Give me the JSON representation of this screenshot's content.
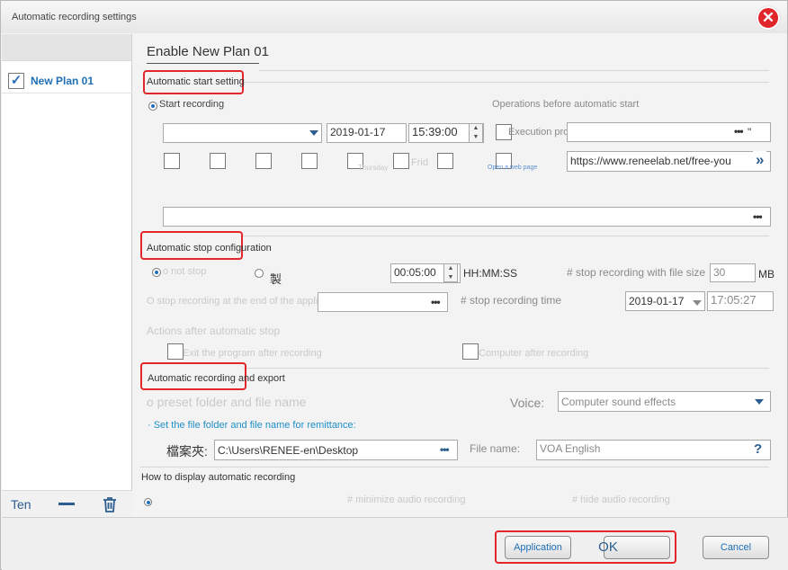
{
  "window": {
    "title": "Automatic recording settings"
  },
  "sidebar": {
    "plans": [
      {
        "label": "New Plan 01",
        "checked": true
      }
    ],
    "footer": {
      "add_label": "Ten"
    }
  },
  "main": {
    "plan_title": "Enable New Plan 01",
    "start": {
      "section_label": "Automatic start setting",
      "start_recording_label": "Start recording",
      "operations_label": "Operations before automatic start",
      "date": "2019-01-17",
      "time": "15:39:00",
      "execution_program_label": "Execution program",
      "execution_program_field": "\"",
      "weekdays": [
        "Thursday",
        "Frid"
      ],
      "open_web_page_label": "Open a web page",
      "url": "https://www.reneelab.net/free-you"
    },
    "stop": {
      "section_label": "Automatic stop configuration",
      "do_not_stop_label": "o not stop",
      "duration_char": "製",
      "duration_value": "00:05:00",
      "duration_format": "HH:MM:SS",
      "file_size_label": "# stop recording with file size",
      "file_size_value": "30",
      "file_size_unit": "MB",
      "end_app_label": "O stop recording at the end of the application",
      "stop_time_label": "# stop recording time",
      "stop_date": "2019-01-17",
      "stop_time": "17:05:27",
      "after_stop_label": "Actions after automatic stop",
      "exit_program_label": "Exit the program after recording",
      "computer_label": "Computer after recording"
    },
    "export": {
      "section_label": "Automatic recording and export",
      "preset_label": "o preset folder and file name",
      "voice_label": "Voice:",
      "voice_value": "Computer sound effects",
      "remit_label": "· Set the file folder and file name for remittance:",
      "folder_label": "檔案夾:",
      "folder_value": "C:\\Users\\RENEE-en\\Desktop",
      "file_name_label": "File name:",
      "file_name_value": "VOA English",
      "help_label": "?"
    },
    "display": {
      "label": "How to display automatic recording",
      "minimize_label": "# minimize audio recording",
      "hide_label": "# hide audio recording"
    }
  },
  "footer": {
    "application_label": "Application",
    "ok_label": "OK",
    "cancel_label": "Cancel"
  },
  "colors": {
    "accent": "#1f6fb7",
    "highlight": "#e2262a",
    "close": "#e0262a"
  }
}
